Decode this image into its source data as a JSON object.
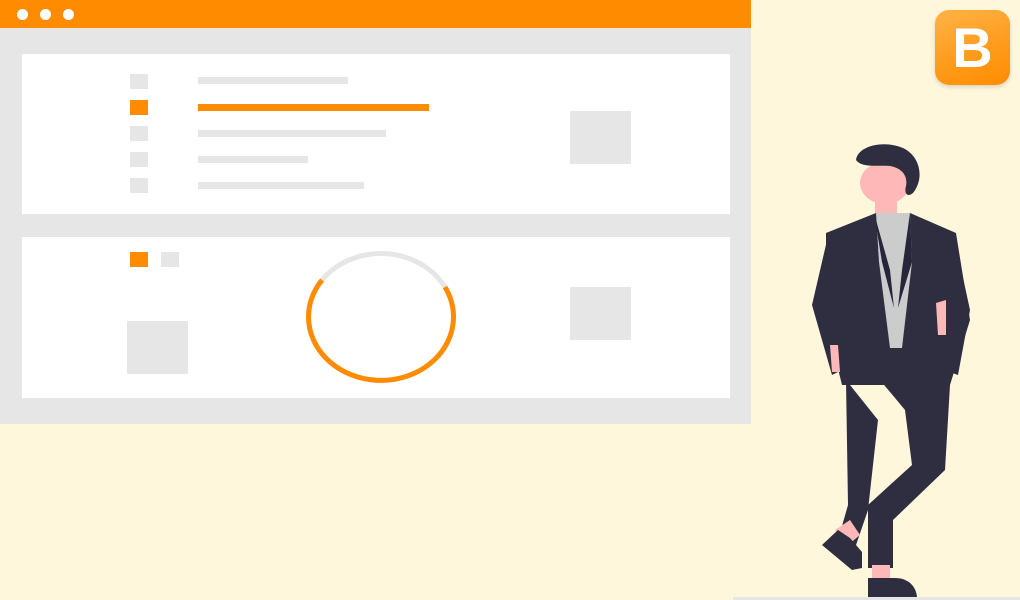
{
  "logo": {
    "letter": "B",
    "color": "#ff8c00"
  },
  "window": {
    "title_bar_color": "#ff8c00",
    "panel_color": "#ffffff",
    "placeholder_color": "#e6e6e6"
  },
  "chart": {
    "type": "donut",
    "accent_color": "#ff8c00",
    "track_color": "#e6e6e6"
  },
  "illustration": {
    "subject": "person-in-suit",
    "background_color": "#fff7dc"
  }
}
